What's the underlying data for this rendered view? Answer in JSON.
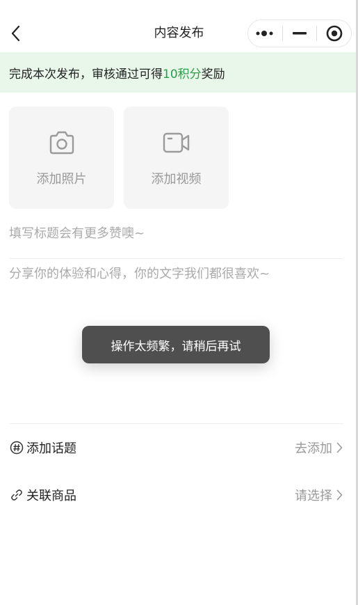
{
  "navbar": {
    "title": "内容发布",
    "back_icon": "chevron-left-icon",
    "capsule_icons": [
      "more-dots-icon",
      "minimize-icon",
      "close-circle-icon"
    ]
  },
  "banner": {
    "prefix": "完成本次发布，审核通过可得",
    "highlight": "10积分",
    "suffix": "奖励",
    "highlight_color": "#2e9a4a",
    "background": "#e9f7ea"
  },
  "media": {
    "photo_label": "添加照片",
    "photo_icon": "camera-icon",
    "video_label": "添加视频",
    "video_icon": "video-camera-icon"
  },
  "form": {
    "title_placeholder": "填写标题会有更多赞噢~",
    "content_placeholder": "分享你的体验和心得，你的文字我们都很喜欢~"
  },
  "toast": {
    "message": "操作太频繁，请稍后再试"
  },
  "options": {
    "topic_label": "添加话题",
    "topic_action": "去添加",
    "topic_icon": "hashtag-icon",
    "product_label": "关联商品",
    "product_action": "请选择",
    "product_icon": "link-icon"
  }
}
